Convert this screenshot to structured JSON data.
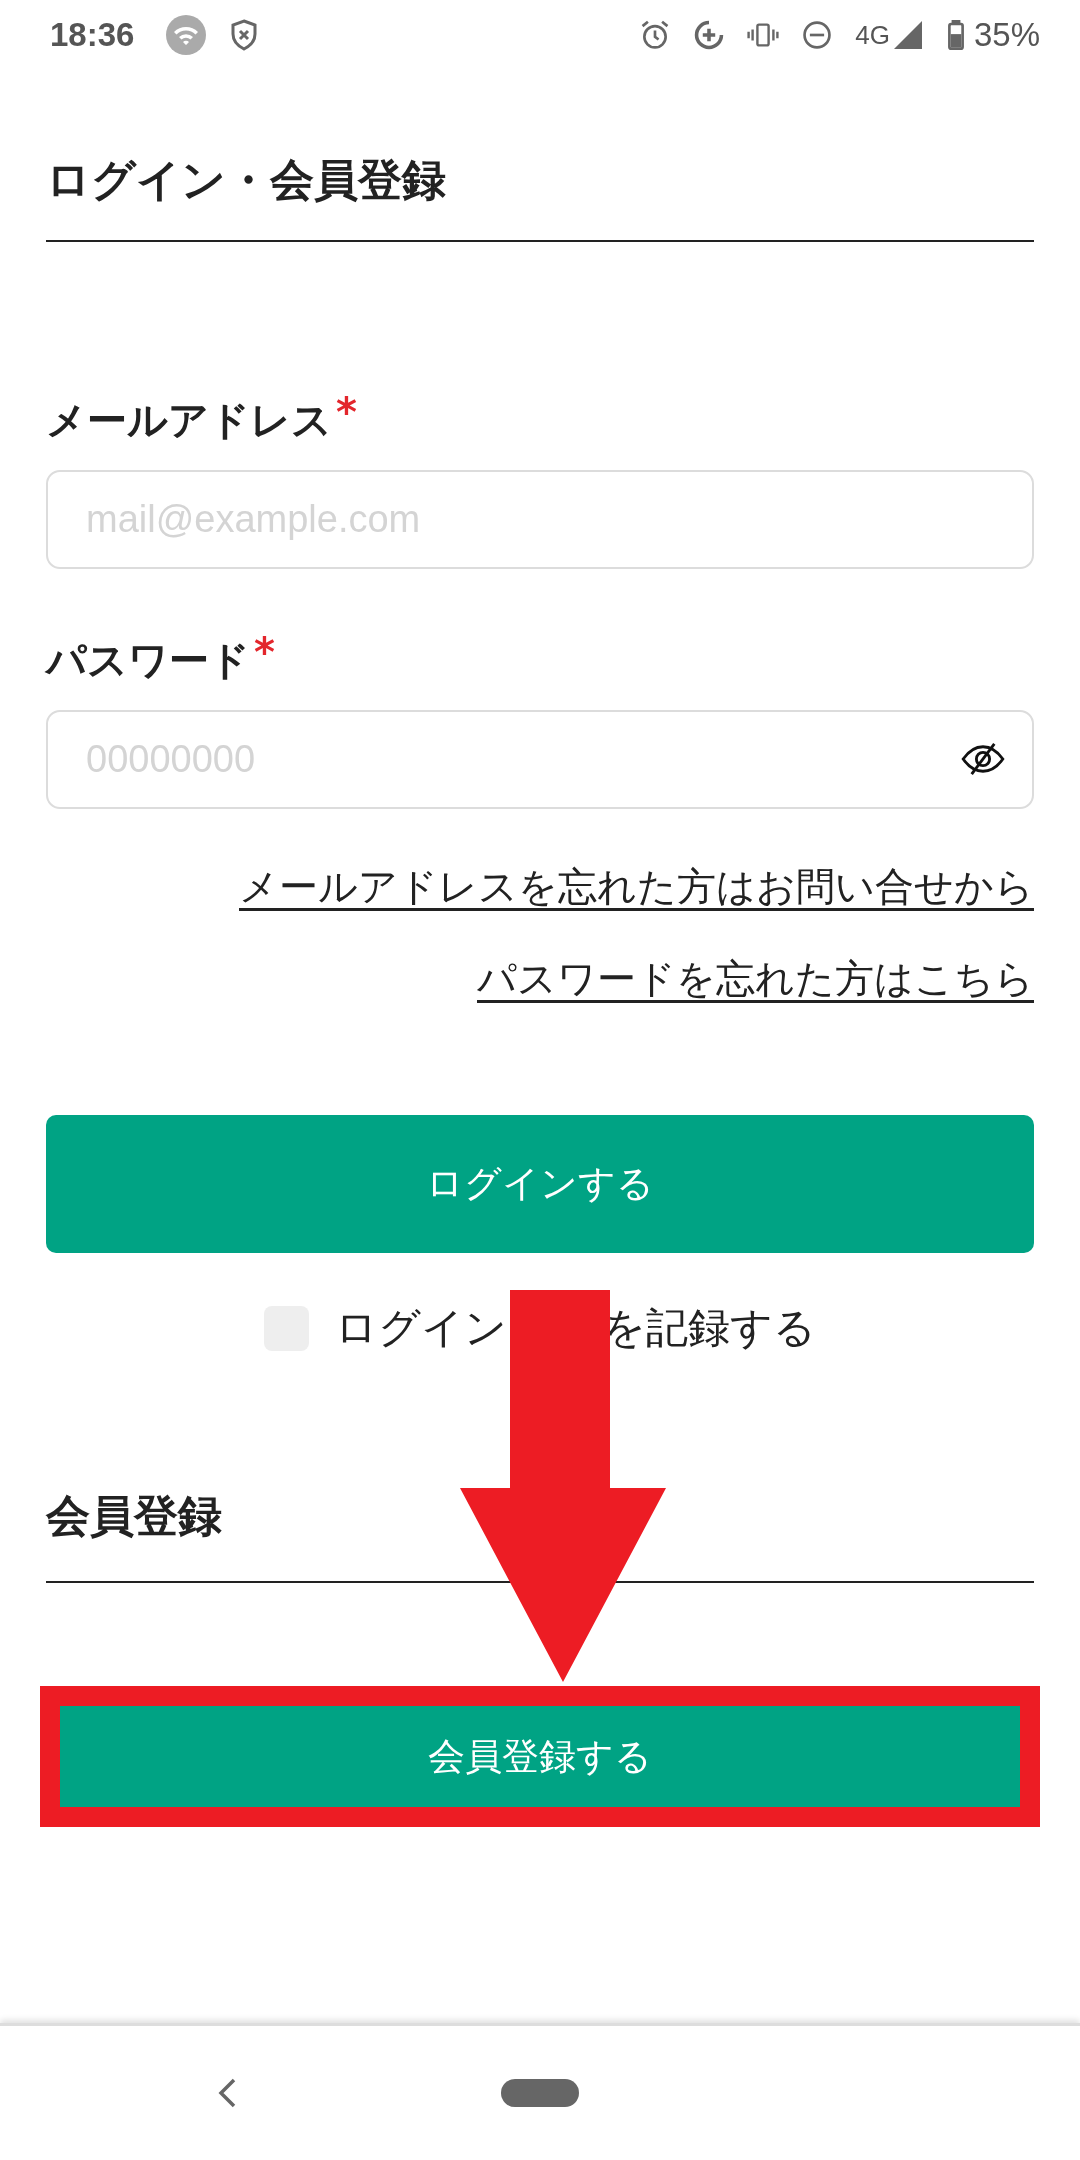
{
  "status_bar": {
    "time": "18:36",
    "network": "4G",
    "battery": "35%"
  },
  "title": "ログイン・会員登録",
  "fields": [
    {
      "label": "メールアドレス",
      "required_mark": "*",
      "placeholder": "mail@example.com",
      "kind": "text"
    },
    {
      "label": "パスワード",
      "required_mark": "*",
      "placeholder": "00000000",
      "kind": "password"
    }
  ],
  "links": [
    "メールアドレスを忘れた方はお問い合せから",
    "パスワードを忘れた方はこちら"
  ],
  "login_button": "ログインする",
  "remember": {
    "checked": false,
    "label_before": "ログイン",
    "label_after": "を記録する"
  },
  "register_heading": "会員登録",
  "register_button": {
    "label": "会員登録する",
    "highlighted": true
  },
  "annotations": [
    {
      "kind": "arrow"
    }
  ]
}
